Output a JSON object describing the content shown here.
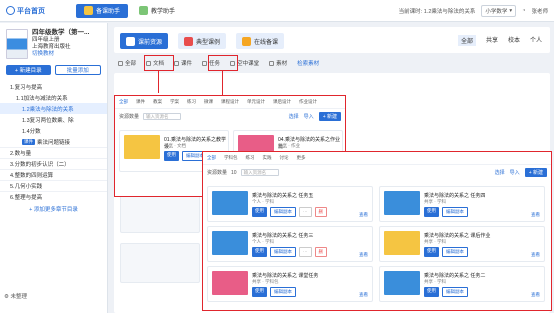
{
  "topbar": {
    "home": "平台首页",
    "tabs": [
      {
        "label": "备课助手"
      },
      {
        "label": "教学助手"
      }
    ],
    "current_lesson": "当前课时: 1.2乘法与除法的关系",
    "subject": "小学数学",
    "user": "张老师"
  },
  "sidebar": {
    "book_title": "四年级数学（第一...",
    "book_grade": "四年级上册",
    "book_publisher": "上海教育出版社",
    "switch": "切换教材",
    "btn_add": "+ 新建目录",
    "btn_batch": "批量添加",
    "tree": [
      {
        "label": "1.复习与提高",
        "level": 1
      },
      {
        "label": "1.1加法与减法的关系",
        "level": 2
      },
      {
        "label": "1.2乘法与除法的关系",
        "level": 3,
        "active": true
      },
      {
        "label": "1.3复习两位数乘、除",
        "level": 3
      },
      {
        "label": "1.4分数",
        "level": 3
      },
      {
        "label": "乘法问题链接",
        "level": 3,
        "badge": "课件"
      },
      {
        "label": "2.数与量",
        "level": 1
      },
      {
        "label": "3.分数的初步认识（二）",
        "level": 1
      },
      {
        "label": "4.整数的四则运算",
        "level": 1
      },
      {
        "label": "5.几何小实践",
        "level": 1
      },
      {
        "label": "6.整理与提高",
        "level": 1
      }
    ],
    "add_catalog": "+ 添加更多章节目录",
    "footer": "未整理"
  },
  "toolbar": {
    "buttons": [
      {
        "label": "课前资源"
      },
      {
        "label": "典型课例"
      },
      {
        "label": "在线备课"
      }
    ],
    "right": [
      {
        "label": "全部"
      },
      {
        "label": "共享"
      },
      {
        "label": "校本"
      },
      {
        "label": "个人"
      }
    ]
  },
  "filters": [
    {
      "label": "全部"
    },
    {
      "label": "文档"
    },
    {
      "label": "课件"
    },
    {
      "label": "任务"
    },
    {
      "label": "空中课堂"
    },
    {
      "label": "素材"
    }
  ],
  "filter_more": "检索素材",
  "panel_small": {
    "tabs": [
      "全部",
      "课件",
      "教案",
      "学案",
      "练习",
      "微课",
      "课程设计",
      "单元设计",
      "课后设计",
      "作业设计"
    ],
    "count": "资源数量",
    "search_placeholder": "输入资源名",
    "actions": [
      "选择",
      "导入",
      "+ 新建"
    ],
    "cards": [
      {
        "title": "01.乘法与除法的关系之教学设...",
        "meta1": "共享",
        "meta2": "文档",
        "share": "查看"
      },
      {
        "title": "04.乘法与除法的关系之作业篇...",
        "meta1": "共享",
        "meta2": "作业",
        "share": "查看"
      }
    ]
  },
  "panel_large": {
    "tabs": [
      "全部",
      "学科包",
      "练习",
      "实践",
      "讨论",
      "更多"
    ],
    "count": "资源数量",
    "count_num": "10",
    "search_placeholder": "输入资源名",
    "actions": [
      "选择",
      "导入",
      "+ 新建"
    ],
    "cards": [
      {
        "title": "乘法与除法的关系之 任务五",
        "meta1": "个人",
        "meta2": "学科",
        "share": "查看"
      },
      {
        "title": "乘法与除法的关系之 任务四",
        "meta1": "共享",
        "meta2": "学科",
        "share": "查看"
      },
      {
        "title": "乘法与除法的关系之 任务三",
        "meta1": "个人",
        "meta2": "学科",
        "share": "查看"
      },
      {
        "title": "乘法与除法的关系之 课后作业",
        "meta1": "共享",
        "meta2": "学科",
        "share": "查看"
      },
      {
        "title": "乘法与除法的关系之 课堂任务",
        "meta1": "共享",
        "meta2": "学科包",
        "share": "查看"
      },
      {
        "title": "乘法与除法的关系之 任务二",
        "meta1": "共享",
        "meta2": "学科",
        "share": "查看"
      }
    ],
    "btn_use": "使用",
    "btn_edit": "编辑副本",
    "btn_more": "···",
    "btn_del": "删"
  },
  "colors": {
    "accent": "#2a6fd6",
    "highlight": "#e0262d"
  }
}
